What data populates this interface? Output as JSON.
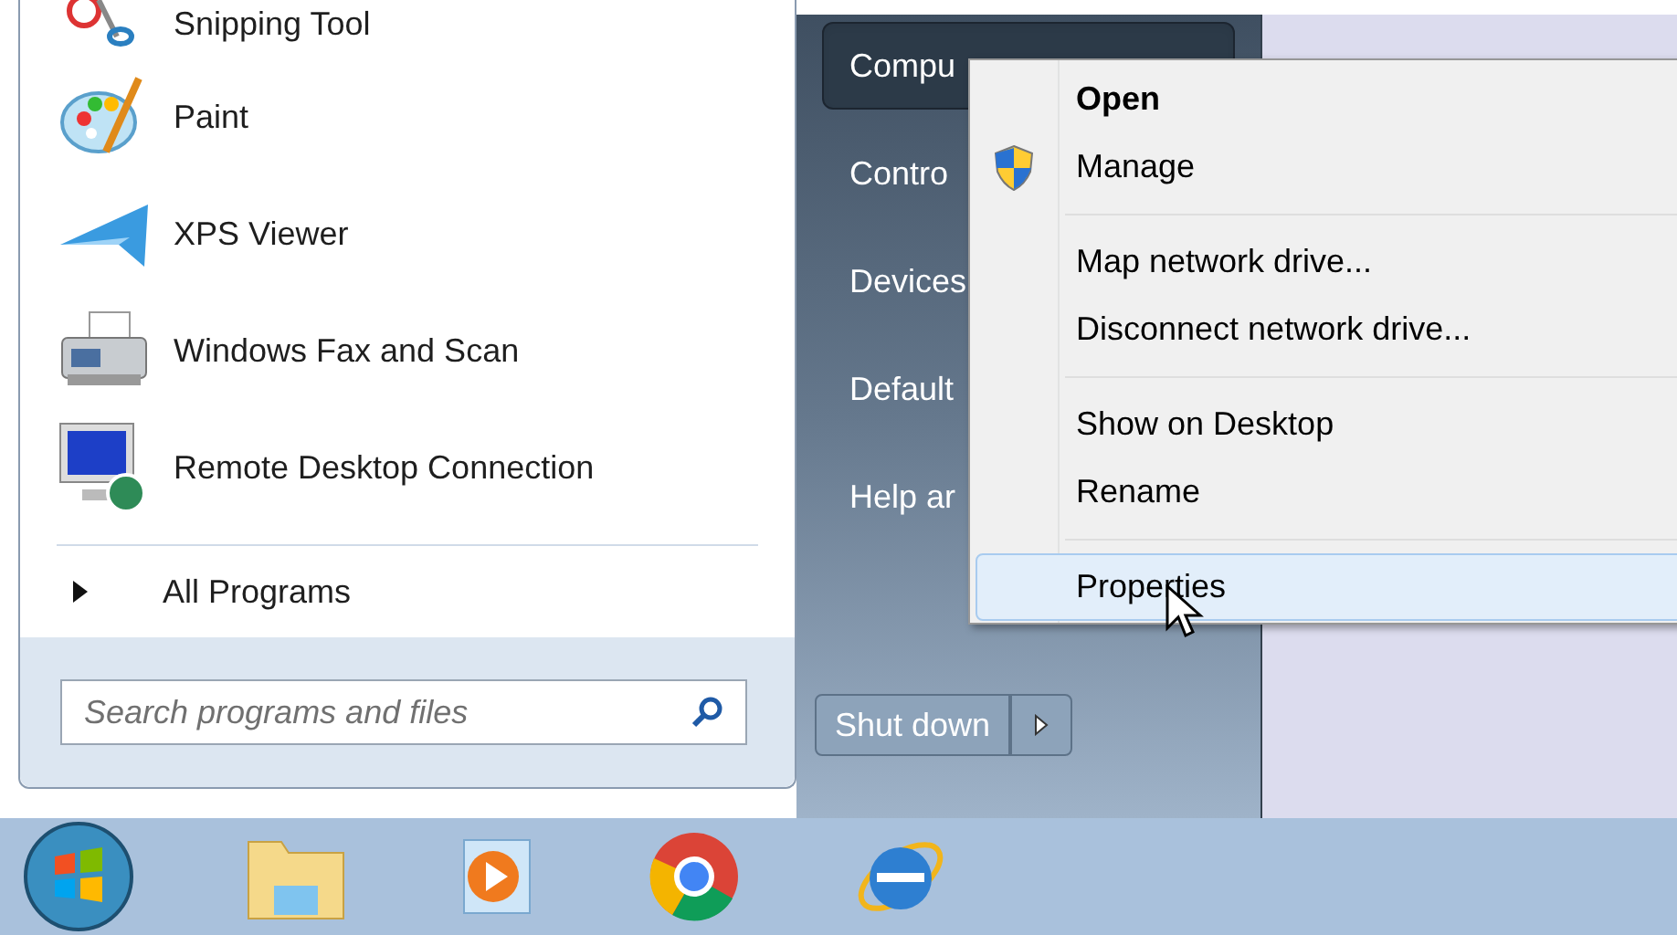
{
  "programs": [
    {
      "label": "Snipping Tool",
      "kind": "scissors"
    },
    {
      "label": "Paint",
      "kind": "palette"
    },
    {
      "label": "XPS Viewer",
      "kind": "plane"
    },
    {
      "label": "Windows Fax and Scan",
      "kind": "fax"
    },
    {
      "label": "Remote Desktop Connection",
      "kind": "monitor"
    }
  ],
  "all_programs": "All Programs",
  "search": {
    "placeholder": "Search programs and files"
  },
  "places": [
    {
      "label": "Compu",
      "selected": true
    },
    {
      "label": "Contro",
      "selected": false
    },
    {
      "label": "Devices",
      "selected": false
    },
    {
      "label": "Default",
      "selected": false
    },
    {
      "label": "Help ar",
      "selected": false
    }
  ],
  "shutdown": {
    "label": "Shut down"
  },
  "context_menu": {
    "groups": [
      [
        {
          "label": "Open",
          "default": true,
          "shield": false,
          "selected": false
        },
        {
          "label": "Manage",
          "default": false,
          "shield": true,
          "selected": false
        }
      ],
      [
        {
          "label": "Map network drive...",
          "default": false,
          "shield": false,
          "selected": false
        },
        {
          "label": "Disconnect network drive...",
          "default": false,
          "shield": false,
          "selected": false
        }
      ],
      [
        {
          "label": "Show on Desktop",
          "default": false,
          "shield": false,
          "selected": false
        },
        {
          "label": "Rename",
          "default": false,
          "shield": false,
          "selected": false
        }
      ],
      [
        {
          "label": "Properties",
          "default": false,
          "shield": false,
          "selected": true
        }
      ]
    ]
  }
}
